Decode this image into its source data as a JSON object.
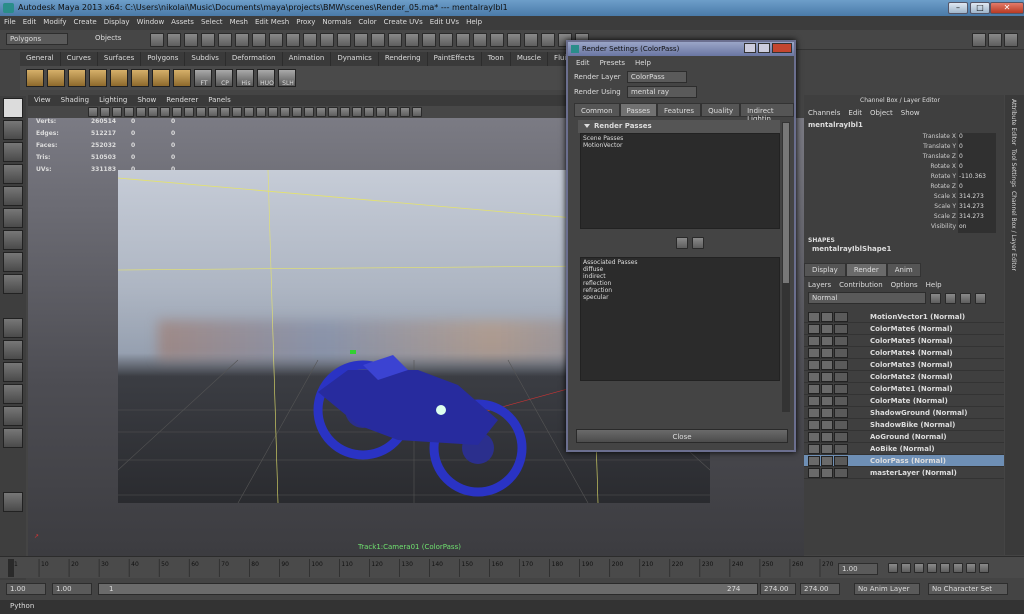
{
  "window": {
    "title": "Autodesk Maya 2013 x64: C:\\Users\\nikolai\\Music\\Documents\\maya\\projects\\BMW\\scenes\\Render_05.ma*  ---  mentalrayIbl1"
  },
  "menubar": [
    "File",
    "Edit",
    "Modify",
    "Create",
    "Display",
    "Window",
    "Assets",
    "Select",
    "Mesh",
    "Edit Mesh",
    "Proxy",
    "Normals",
    "Color",
    "Create UVs",
    "Edit UVs",
    "Help"
  ],
  "status": {
    "mode": "Polygons",
    "selection": "Objects"
  },
  "shelf": {
    "tabs": [
      "General",
      "Curves",
      "Surfaces",
      "Polygons",
      "Subdivs",
      "Deformation",
      "Animation",
      "Dynamics",
      "Rendering",
      "PaintEffects",
      "Toon",
      "Muscle",
      "Fluids",
      "Fur"
    ],
    "buttons": [
      "FT",
      "CP",
      "His",
      "HUO",
      "SLH"
    ]
  },
  "panel": {
    "menu": [
      "View",
      "Shading",
      "Lighting",
      "Show",
      "Renderer",
      "Panels"
    ],
    "hud": [
      {
        "label": "Verts:",
        "a": "260514",
        "b": "0",
        "c": "0"
      },
      {
        "label": "Edges:",
        "a": "512217",
        "b": "0",
        "c": "0"
      },
      {
        "label": "Faces:",
        "a": "252032",
        "b": "0",
        "c": "0"
      },
      {
        "label": "Tris:",
        "a": "510503",
        "b": "0",
        "c": "0"
      },
      {
        "label": "UVs:",
        "a": "331183",
        "b": "0",
        "c": "0"
      }
    ],
    "camera": "Track1:Camera01 (ColorPass)"
  },
  "render_settings": {
    "title": "Render Settings (ColorPass)",
    "menu": [
      "Edit",
      "Presets",
      "Help"
    ],
    "layer_label": "Render Layer",
    "layer_value": "ColorPass",
    "using_label": "Render Using",
    "using_value": "mental ray",
    "tabs": [
      "Common",
      "Passes",
      "Features",
      "Quality",
      "Indirect Lightin"
    ],
    "section": "Render Passes",
    "scene_passes_label": "Scene Passes",
    "scene_passes": [
      "MotionVector"
    ],
    "assoc_label": "Associated Passes",
    "assoc_passes": [
      "diffuse",
      "indirect",
      "reflection",
      "refraction",
      "specular"
    ],
    "close": "Close"
  },
  "channel_box": {
    "header": "Channel Box / Layer Editor",
    "menu": [
      "Channels",
      "Edit",
      "Object",
      "Show"
    ],
    "node": "mentalrayIbl1",
    "attrs": [
      {
        "n": "Translate X",
        "v": "0"
      },
      {
        "n": "Translate Y",
        "v": "0"
      },
      {
        "n": "Translate Z",
        "v": "0"
      },
      {
        "n": "Rotate X",
        "v": "0"
      },
      {
        "n": "Rotate Y",
        "v": "-110.363"
      },
      {
        "n": "Rotate Z",
        "v": "0"
      },
      {
        "n": "Scale X",
        "v": "314.273"
      },
      {
        "n": "Scale Y",
        "v": "314.273"
      },
      {
        "n": "Scale Z",
        "v": "314.273"
      },
      {
        "n": "Visibility",
        "v": "on"
      }
    ],
    "shapes_label": "SHAPES",
    "shape": "mentalrayIblShape1"
  },
  "layers": {
    "tabs": [
      "Display",
      "Render",
      "Anim"
    ],
    "menu": [
      "Layers",
      "Contribution",
      "Options",
      "Help"
    ],
    "blend": "Normal",
    "items": [
      "MotionVector1 (Normal)",
      "ColorMate6 (Normal)",
      "ColorMate5 (Normal)",
      "ColorMate4 (Normal)",
      "ColorMate3 (Normal)",
      "ColorMate2 (Normal)",
      "ColorMate1 (Normal)",
      "ColorMate (Normal)",
      "ShadowGround (Normal)",
      "ShadowBike (Normal)",
      "AoGround (Normal)",
      "AoBike (Normal)",
      "ColorPass (Normal)",
      "masterLayer (Normal)"
    ],
    "selected_index": 12
  },
  "side_tabs": [
    "Attribute Editor",
    "Tool Settings",
    "Channel Box / Layer Editor"
  ],
  "timeline": {
    "ticks": [
      "1",
      "10",
      "20",
      "30",
      "40",
      "50",
      "60",
      "70",
      "80",
      "90",
      "100",
      "110",
      "120",
      "130",
      "140",
      "150",
      "160",
      "170",
      "180",
      "190",
      "200",
      "210",
      "220",
      "230",
      "240",
      "250",
      "260",
      "270"
    ],
    "current": "1.00"
  },
  "range": {
    "start": "1.00",
    "start2": "1.00",
    "marker": "1",
    "end_marker": "274",
    "end": "274.00",
    "end2": "274.00",
    "anim_layer": "No Anim Layer",
    "char_set": "No Character Set"
  },
  "cmdline": "Python"
}
